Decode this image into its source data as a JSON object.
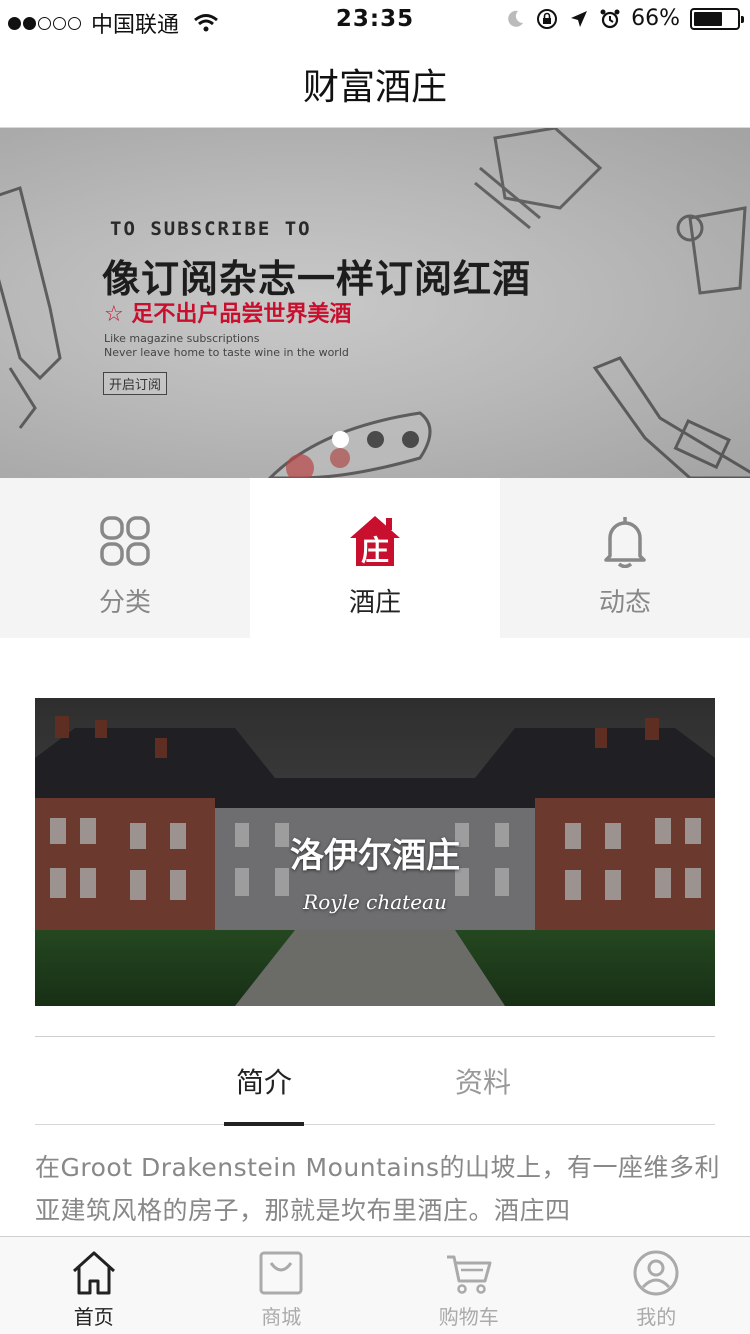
{
  "status_bar": {
    "carrier": "中国联通",
    "time": "23:35",
    "battery_percent": "66%",
    "battery_level": 0.66,
    "signal_bars_filled": 2,
    "signal_bars_total": 5
  },
  "nav": {
    "title": "财富酒庄"
  },
  "banner": {
    "eyebrow": "TO SUBSCRIBE TO",
    "headline": "像订阅杂志一样订阅红酒",
    "tagline": "☆ 足不出户品尝世界美酒",
    "sub_line_1": "Like magazine subscriptions",
    "sub_line_2": "Never leave home to taste wine in the world",
    "button": "开启订阅",
    "pages": 3,
    "active_page": 1
  },
  "category_tabs": [
    {
      "label": "分类",
      "icon": "grid-icon",
      "active": false
    },
    {
      "label": "酒庄",
      "icon": "winery-house-icon",
      "active": true
    },
    {
      "label": "动态",
      "icon": "bell-icon",
      "active": false
    }
  ],
  "winery": {
    "name": "洛伊尔酒庄",
    "subtitle": "Royle chateau"
  },
  "info_tabs": [
    {
      "label": "简介",
      "active": true
    },
    {
      "label": "资料",
      "active": false
    }
  ],
  "intro": {
    "text": "在Groot Drakenstein Mountains的山坡上，有一座维多利亚建筑风格的房子，那就是坎布里酒庄。酒庄四"
  },
  "bottom_tabs": [
    {
      "label": "首页",
      "icon": "home-icon",
      "active": true
    },
    {
      "label": "商城",
      "icon": "shopping-bag-icon",
      "active": false
    },
    {
      "label": "购物车",
      "icon": "cart-icon",
      "active": false
    },
    {
      "label": "我的",
      "icon": "profile-icon",
      "active": false
    }
  ],
  "colors": {
    "accent": "#c8102e",
    "text_dark": "#222222",
    "text_muted": "#999999",
    "tab_bg": "#f4f4f4"
  }
}
